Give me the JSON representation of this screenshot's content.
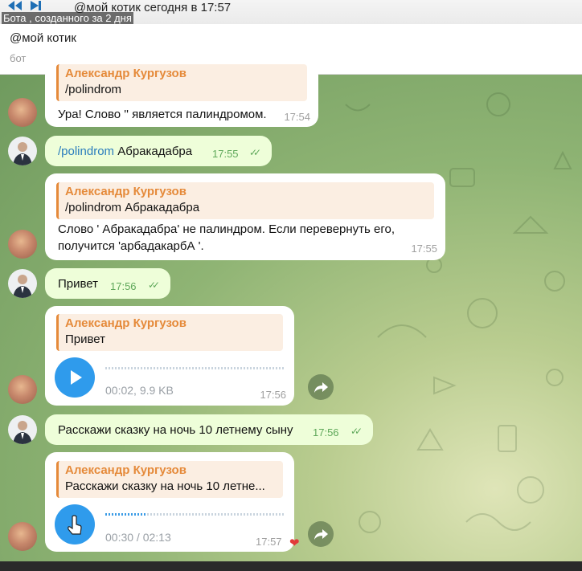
{
  "topbar": {
    "prev_icon": "rewind-icon",
    "next_icon": "play-forward-icon",
    "title": "@мой котик сегодня в 17:57",
    "subtitle": "Бота , созданного за 2 дня"
  },
  "header": {
    "name": "@мой котик",
    "status": "бот"
  },
  "messages": {
    "m1": {
      "reply_name": "Александр Кургузов",
      "reply_text": "/polindrom",
      "text": "Ура! Слово '' является палиндромом.",
      "time": "17:54"
    },
    "m2": {
      "cmd": "/polindrom",
      "text": "Абракадабра",
      "time": "17:55"
    },
    "m3": {
      "reply_name": "Александр Кургузов",
      "reply_text": "/polindrom  Абракадабра",
      "line1": "Слово ' Абракадабра' не палиндром. Если перевернуть его,",
      "line2": "получится 'арбадакарбА '.",
      "time": "17:55"
    },
    "m4": {
      "text": "Привет",
      "time": "17:56"
    },
    "m5": {
      "reply_name": "Александр Кургузов",
      "reply_text": "Привет",
      "duration": "00:02, 9.9 KB",
      "time": "17:56",
      "progress": 0
    },
    "m6": {
      "text": "Расскажи  сказку на ночь 10 летнему сыну",
      "time": "17:56"
    },
    "m7": {
      "reply_name": "Александр Кургузов",
      "reply_text": "Расскажи  сказку на ночь 10 летне...",
      "duration": "00:30 / 02:13",
      "time": "17:57",
      "progress": 0.23,
      "reaction": "❤"
    }
  }
}
